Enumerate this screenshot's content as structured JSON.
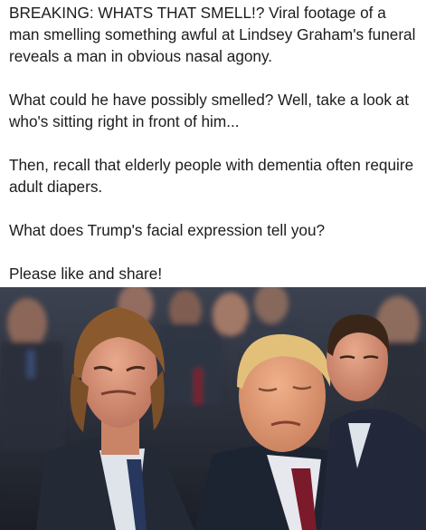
{
  "post": {
    "paragraphs": [
      "BREAKING: WHATS THAT SMELL!? Viral footage of a man smelling something awful at Lindsey Graham's funeral reveals a man in obvious nasal agony.",
      "What could he have possibly smelled? Well, take a look at who's sitting right in front of him...",
      "Then, recall that elderly people with dementia often require adult diapers.",
      "What does Trump's facial expression tell you?",
      "Please like and share!"
    ]
  },
  "colors": {
    "text": "#1c1c1c",
    "background": "#ffffff",
    "photo_dark": "#20232b"
  }
}
